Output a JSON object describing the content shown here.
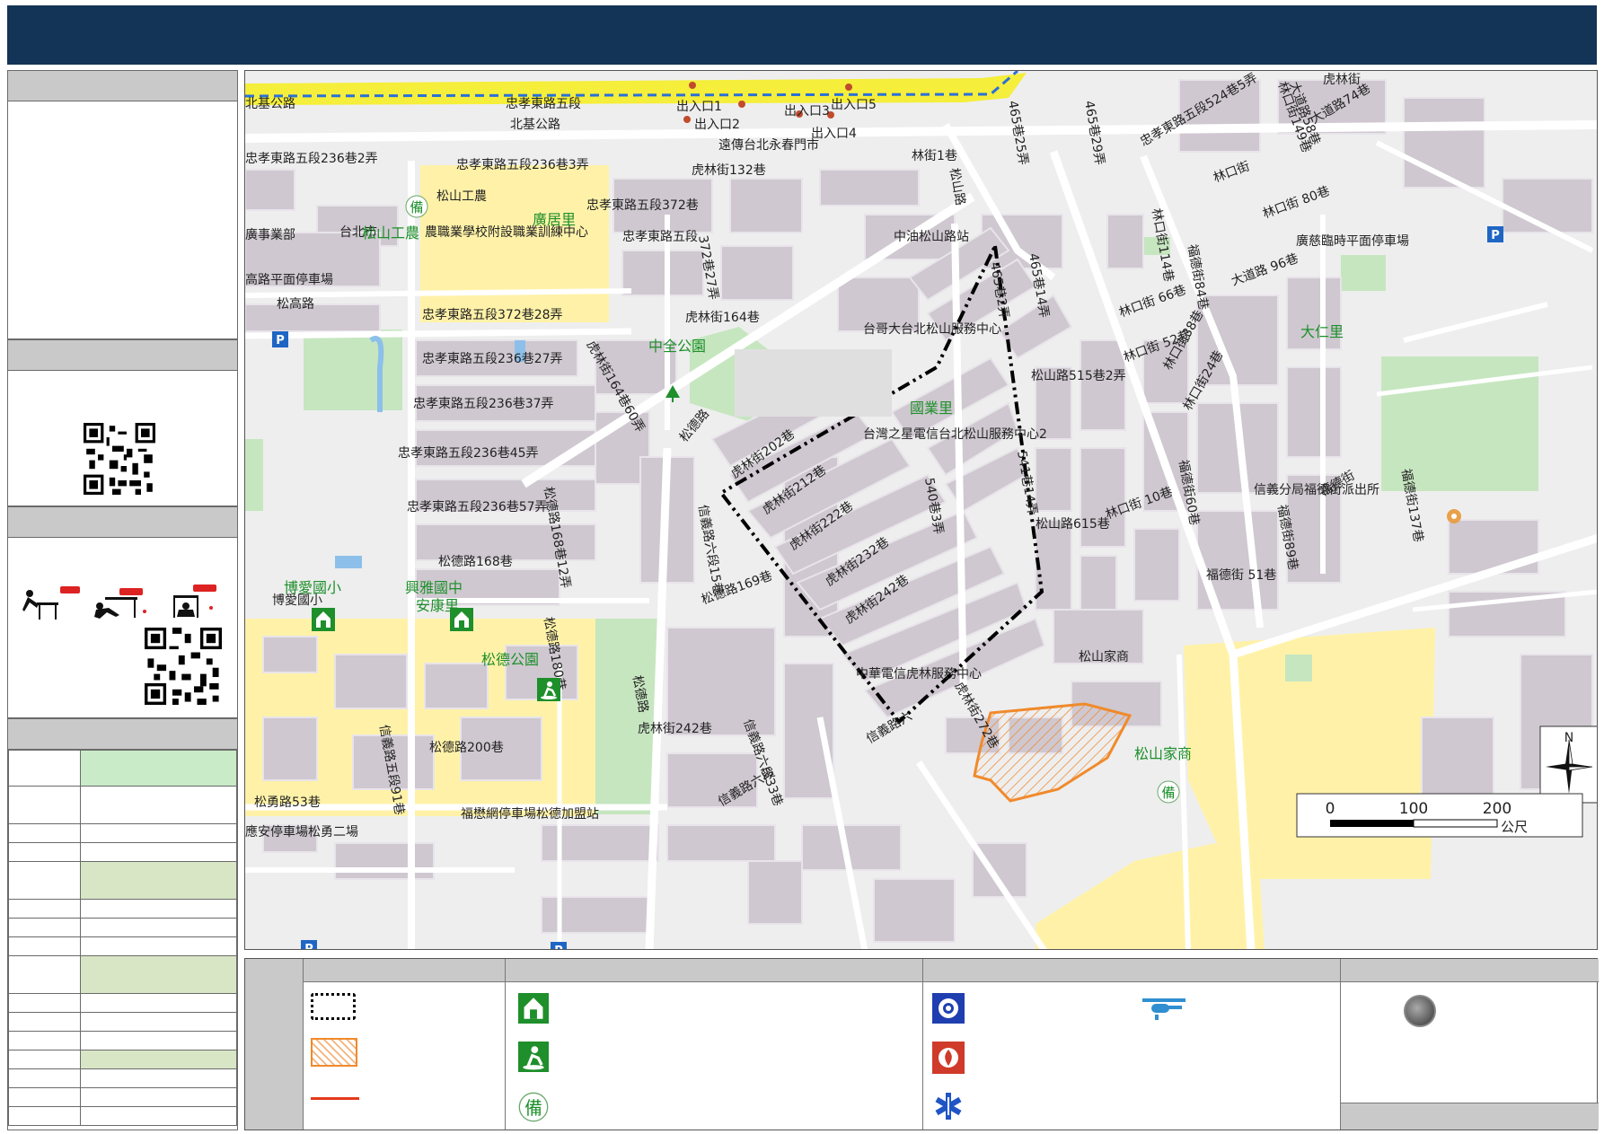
{
  "map": {
    "streets": [
      {
        "id": "s1",
        "text": "北基公路"
      },
      {
        "id": "s2",
        "text": "忠孝東路五段"
      },
      {
        "id": "s3",
        "text": "北基公路"
      },
      {
        "id": "s4",
        "text": "出入口1"
      },
      {
        "id": "s5",
        "text": "出入口2"
      },
      {
        "id": "s6",
        "text": "出入口3"
      },
      {
        "id": "s7",
        "text": "出入口4"
      },
      {
        "id": "s8",
        "text": "出入口5"
      },
      {
        "id": "s9",
        "text": "遠傳台北永春門市"
      },
      {
        "id": "s10",
        "text": "忠孝東路五段236巷2弄"
      },
      {
        "id": "s11",
        "text": "忠孝東路五段236巷3弄"
      },
      {
        "id": "s12",
        "text": "虎林街132巷"
      },
      {
        "id": "s13",
        "text": "忠孝東路五段372巷"
      },
      {
        "id": "s14",
        "text": "忠孝東路五段"
      },
      {
        "id": "s15",
        "text": "372巷27弄"
      },
      {
        "id": "s16",
        "text": "松高路"
      },
      {
        "id": "s17",
        "text": "高路平面停車場"
      },
      {
        "id": "s18",
        "text": "忠孝東路五段372巷28弄"
      },
      {
        "id": "s19",
        "text": "虎林街164巷"
      },
      {
        "id": "s20",
        "text": "忠孝東路五段236巷27弄"
      },
      {
        "id": "s21",
        "text": "忠孝東路五段236巷37弄"
      },
      {
        "id": "s22",
        "text": "忠孝東路五段236巷45弄"
      },
      {
        "id": "s23",
        "text": "忠孝東路五段236巷57弄"
      },
      {
        "id": "s24",
        "text": "松德路168巷"
      },
      {
        "id": "s25",
        "text": "松德路168巷12弄"
      },
      {
        "id": "s26",
        "text": "松德路180巷"
      },
      {
        "id": "s27",
        "text": "虎林街164巷60弄"
      },
      {
        "id": "s28",
        "text": "松德路"
      },
      {
        "id": "s29",
        "text": "虎林街202巷"
      },
      {
        "id": "s30",
        "text": "虎林街212巷"
      },
      {
        "id": "s31",
        "text": "虎林街222巷"
      },
      {
        "id": "s32",
        "text": "虎林街232巷"
      },
      {
        "id": "s33",
        "text": "虎林街242巷"
      },
      {
        "id": "s34",
        "text": "松德路169巷"
      },
      {
        "id": "s35",
        "text": "信義路六段15巷"
      },
      {
        "id": "s36",
        "text": "虎林街242巷"
      },
      {
        "id": "s37",
        "text": "松德路200巷"
      },
      {
        "id": "s38",
        "text": "信義路五段91巷"
      },
      {
        "id": "s39",
        "text": "松勇路53巷"
      },
      {
        "id": "s40",
        "text": "福懋網停車場松德加盟站"
      },
      {
        "id": "s41",
        "text": "應安停車場松勇二場"
      },
      {
        "id": "s42",
        "text": "信義路六段33巷"
      },
      {
        "id": "s43",
        "text": "信義路六段"
      },
      {
        "id": "s44",
        "text": "松德路"
      },
      {
        "id": "s45",
        "text": "中油松山路站"
      },
      {
        "id": "s46",
        "text": "台哥大台北松山服務中心"
      },
      {
        "id": "s47",
        "text": "台灣之星電信台北松山服務中心2"
      },
      {
        "id": "s48",
        "text": "中華電信虎林服務中心"
      },
      {
        "id": "s49",
        "text": "松山路"
      },
      {
        "id": "s50",
        "text": "465巷2弄"
      },
      {
        "id": "s51",
        "text": "465巷14弄"
      },
      {
        "id": "s52",
        "text": "松山路515巷2弄"
      },
      {
        "id": "s53",
        "text": "541巷14弄"
      },
      {
        "id": "s54",
        "text": "540巷3弄"
      },
      {
        "id": "s55",
        "text": "松山路615巷"
      },
      {
        "id": "s56",
        "text": "林口街 66巷"
      },
      {
        "id": "s57",
        "text": "林口街 52巷"
      },
      {
        "id": "s58",
        "text": "林口街38巷"
      },
      {
        "id": "s59",
        "text": "林口街24巷"
      },
      {
        "id": "s60",
        "text": "林口街 10巷"
      },
      {
        "id": "s61",
        "text": "林口街 80巷"
      },
      {
        "id": "s62",
        "text": "林口街"
      },
      {
        "id": "s63",
        "text": "大道路 96巷"
      },
      {
        "id": "s64",
        "text": "廣慈臨時平面停車場"
      },
      {
        "id": "s65",
        "text": "信義分局福德街派出所"
      },
      {
        "id": "s66",
        "text": "福德街 51巷"
      },
      {
        "id": "s67",
        "text": "福德街"
      },
      {
        "id": "s68",
        "text": "松山家商"
      },
      {
        "id": "s69",
        "text": "虎林街"
      },
      {
        "id": "s70",
        "text": "忠孝東路五段524巷5弄"
      },
      {
        "id": "s71",
        "text": "大道路58巷"
      },
      {
        "id": "s72",
        "text": "大道路74巷"
      },
      {
        "id": "s73",
        "text": "林口街149巷"
      },
      {
        "id": "s74",
        "text": "465巷25弄"
      },
      {
        "id": "s75",
        "text": "465巷29弄"
      },
      {
        "id": "s76",
        "text": "林口街114巷"
      },
      {
        "id": "s77",
        "text": "福德街84巷"
      },
      {
        "id": "s78",
        "text": "福德街60巷"
      },
      {
        "id": "s79",
        "text": "福德街89巷"
      },
      {
        "id": "s80",
        "text": "福德街137巷"
      },
      {
        "id": "s81",
        "text": "林街1巷"
      },
      {
        "id": "s82",
        "text": "台北市"
      },
      {
        "id": "s83",
        "text": "農職業學校附設職業訓練中心"
      },
      {
        "id": "s84",
        "text": "廣事業部"
      },
      {
        "id": "s85",
        "text": "松山工農"
      },
      {
        "id": "s86",
        "text": "博愛國小"
      },
      {
        "id": "s87",
        "text": "虎林街272巷"
      },
      {
        "id": "s88",
        "text": "信義路六"
      }
    ],
    "green_labels": [
      {
        "id": "g1",
        "text": "松山工農"
      },
      {
        "id": "g2",
        "text": "廣居里"
      },
      {
        "id": "g3",
        "text": "中全公園"
      },
      {
        "id": "g4",
        "text": "國業里"
      },
      {
        "id": "g5",
        "text": "大仁里"
      },
      {
        "id": "g6",
        "text": "博愛國小"
      },
      {
        "id": "g7",
        "text": "興雅國中"
      },
      {
        "id": "g8",
        "text": "安康里"
      },
      {
        "id": "g9",
        "text": "松德公園"
      },
      {
        "id": "g10",
        "text": "松山家商"
      }
    ],
    "scale": {
      "ticks": [
        "0",
        "100",
        "200"
      ],
      "unit": "公尺"
    },
    "north_label": "N"
  },
  "panels": {
    "qr_label": "QR"
  },
  "colors": {
    "header": "#133456",
    "boundary": "#000000",
    "hazard": "#f08a2c",
    "highway": "#f5ee3a",
    "school": "#fff2a8",
    "park": "#c6e6c0"
  },
  "icons": [
    "shelter-icon",
    "evac-park-icon",
    "reserve-icon",
    "police-icon",
    "fire-icon",
    "medical-icon",
    "helicopter-icon",
    "gray-circle-icon"
  ]
}
